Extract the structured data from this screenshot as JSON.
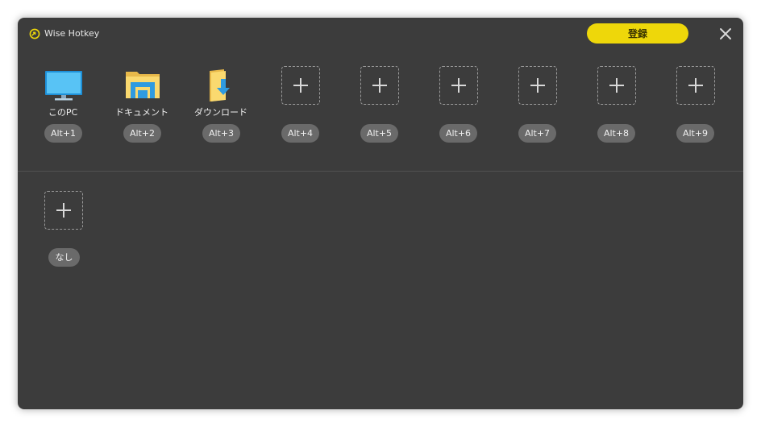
{
  "app": {
    "title": "Wise Hotkey",
    "logo_icon": "wise-logo-icon",
    "accent_color": "#eed70a"
  },
  "header": {
    "register_label": "登録",
    "close_icon": "close-icon"
  },
  "favorites": [
    {
      "label": "このPC",
      "hotkey": "Alt+1",
      "icon": "monitor-icon"
    },
    {
      "label": "ドキュメント",
      "hotkey": "Alt+2",
      "icon": "documents-folder-icon"
    },
    {
      "label": "ダウンロード",
      "hotkey": "Alt+3",
      "icon": "downloads-folder-icon"
    },
    {
      "label": "",
      "hotkey": "Alt+4",
      "icon": "plus-icon"
    },
    {
      "label": "",
      "hotkey": "Alt+5",
      "icon": "plus-icon"
    },
    {
      "label": "",
      "hotkey": "Alt+6",
      "icon": "plus-icon"
    },
    {
      "label": "",
      "hotkey": "Alt+7",
      "icon": "plus-icon"
    },
    {
      "label": "",
      "hotkey": "Alt+8",
      "icon": "plus-icon"
    },
    {
      "label": "",
      "hotkey": "Alt+9",
      "icon": "plus-icon"
    }
  ],
  "extra": [
    {
      "label": "",
      "hotkey": "なし",
      "icon": "plus-icon"
    }
  ]
}
